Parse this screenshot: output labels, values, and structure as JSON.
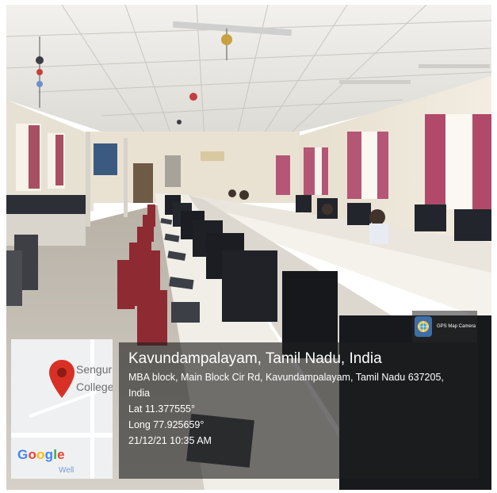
{
  "location": {
    "title": "Kavundampalayam, Tamil Nadu, India",
    "address_line1": "MBA block, Main Block Cir Rd, Kavundampalayam, Tamil Nadu 637205,",
    "address_line2": "India",
    "latitude": "Lat 11.377555°",
    "longitude": "Long 77.925659°",
    "timestamp": "21/12/21 10:35 AM"
  },
  "map": {
    "label_1": "Sengur",
    "label_2": "College",
    "provider_logo": "Google",
    "bottom_text": "Well",
    "pin_icon": "map-pin-icon",
    "pin_color": "#d93025"
  },
  "badge": {
    "text": "GPS Map Camera",
    "icon": "camera-globe-icon"
  },
  "colors": {
    "wall": "#efe9dc",
    "ceiling": "#e9e7e2",
    "curtain": "#b14a6a",
    "chair": "#8e2a32",
    "monitor": "#1b1d22",
    "overlay": "#1e1e1e"
  }
}
